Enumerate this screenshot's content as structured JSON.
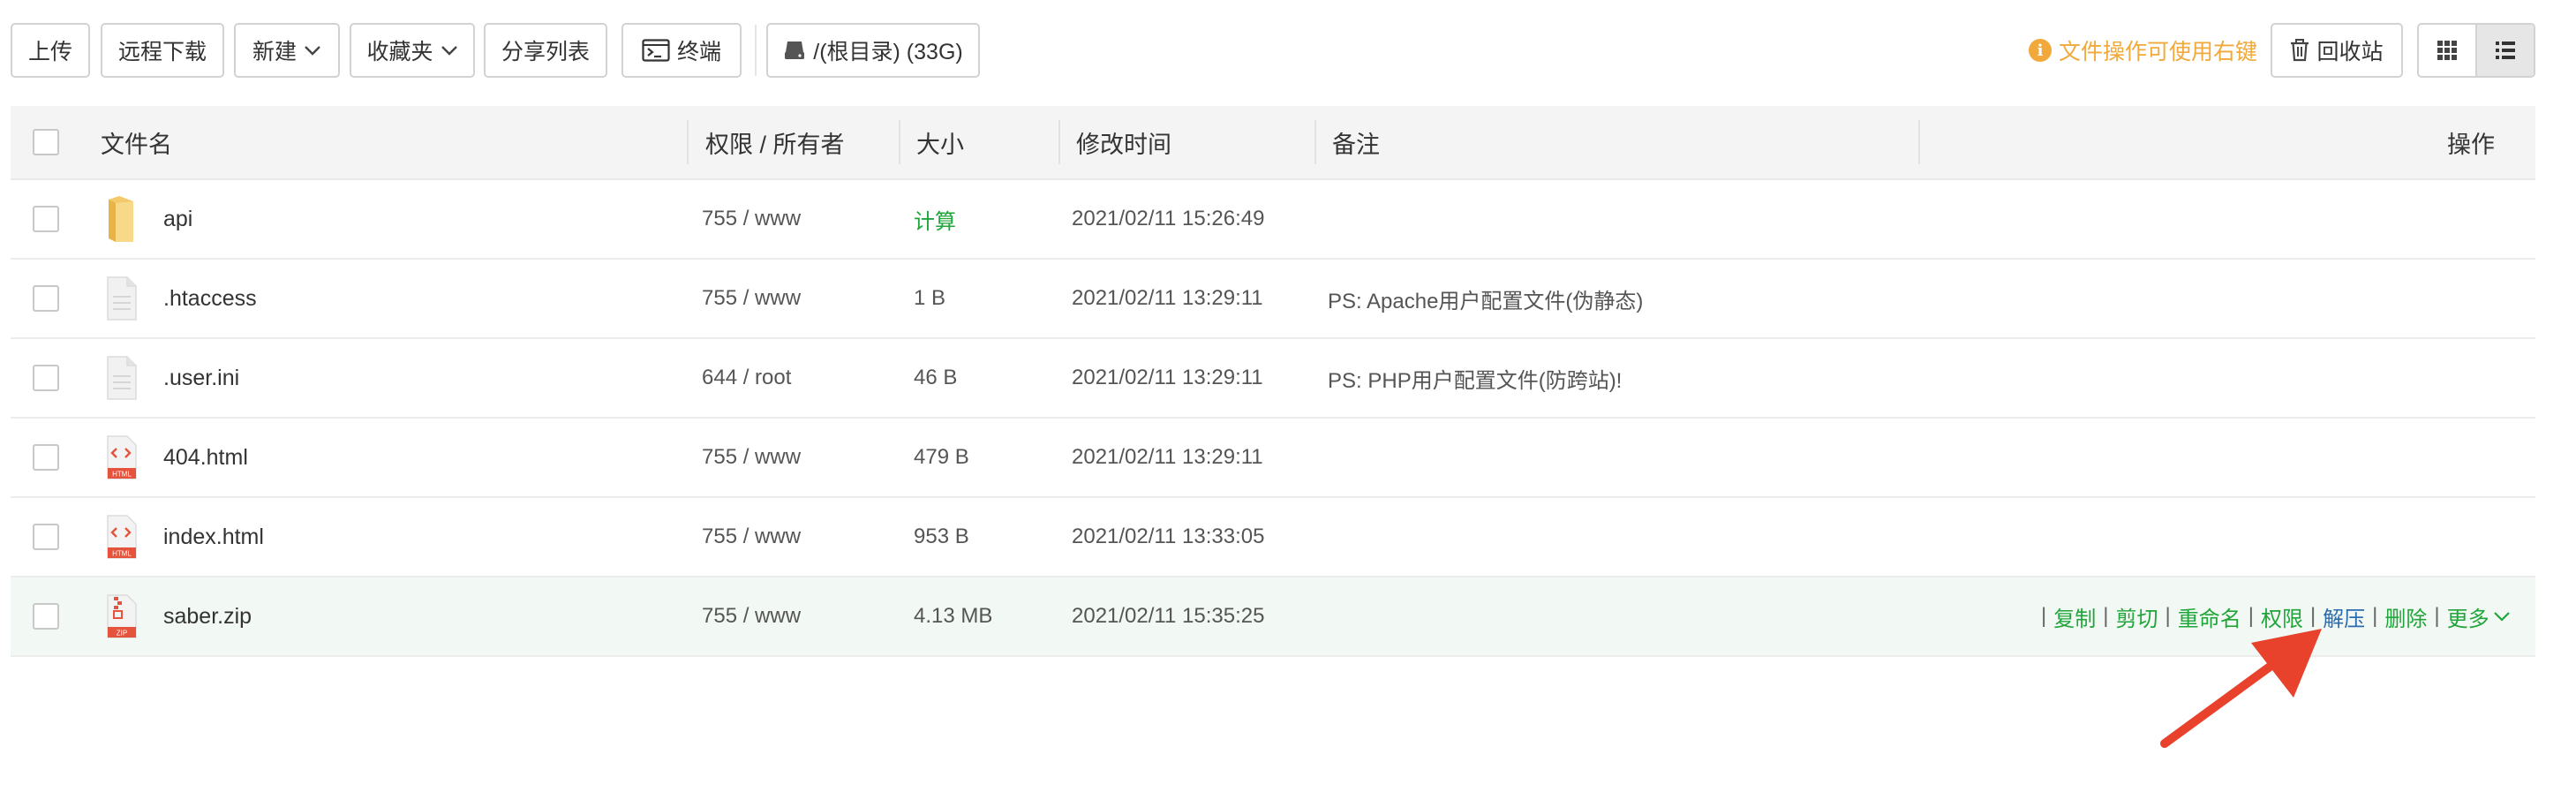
{
  "toolbar": {
    "upload": "上传",
    "remote_download": "远程下载",
    "new": "新建",
    "favorites": "收藏夹",
    "share_list": "分享列表",
    "terminal": "终端",
    "path": "/(根目录) (33G)",
    "tip": "文件操作可使用右键",
    "recycle_bin": "回收站"
  },
  "table": {
    "headers": {
      "name": "文件名",
      "perm": "权限 / 所有者",
      "size": "大小",
      "mtime": "修改时间",
      "note": "备注",
      "ops": "操作"
    },
    "rows": [
      {
        "name": "api",
        "perm": "755 / www",
        "size": "计算",
        "mtime": "2021/02/11 15:26:49",
        "note": "",
        "icon": "folder-icon"
      },
      {
        "name": ".htaccess",
        "perm": "755 / www",
        "size": "1 B",
        "mtime": "2021/02/11 13:29:11",
        "note": "PS: Apache用户配置文件(伪静态)",
        "icon": "text-file-icon"
      },
      {
        "name": ".user.ini",
        "perm": "644 / root",
        "size": "46 B",
        "mtime": "2021/02/11 13:29:11",
        "note": "PS: PHP用户配置文件(防跨站)!",
        "icon": "text-file-icon"
      },
      {
        "name": "404.html",
        "perm": "755 / www",
        "size": "479 B",
        "mtime": "2021/02/11 13:29:11",
        "note": "",
        "icon": "html-file-icon"
      },
      {
        "name": "index.html",
        "perm": "755 / www",
        "size": "953 B",
        "mtime": "2021/02/11 13:33:05",
        "note": "",
        "icon": "html-file-icon"
      },
      {
        "name": "saber.zip",
        "perm": "755 / www",
        "size": "4.13 MB",
        "mtime": "2021/02/11 15:35:25",
        "note": "",
        "icon": "zip-file-icon"
      }
    ],
    "row_actions": {
      "copy": "复制",
      "cut": "剪切",
      "rename": "重命名",
      "perm": "权限",
      "extract": "解压",
      "delete": "删除",
      "more": "更多",
      "sep": "|"
    }
  },
  "icon_labels": {
    "html": "HTML",
    "zip": "ZIP"
  },
  "colors": {
    "accent_green": "#20a53a",
    "tip_orange": "#f0a93a",
    "link_blue": "#2b6cb0",
    "arrow_red": "#e8412c"
  }
}
